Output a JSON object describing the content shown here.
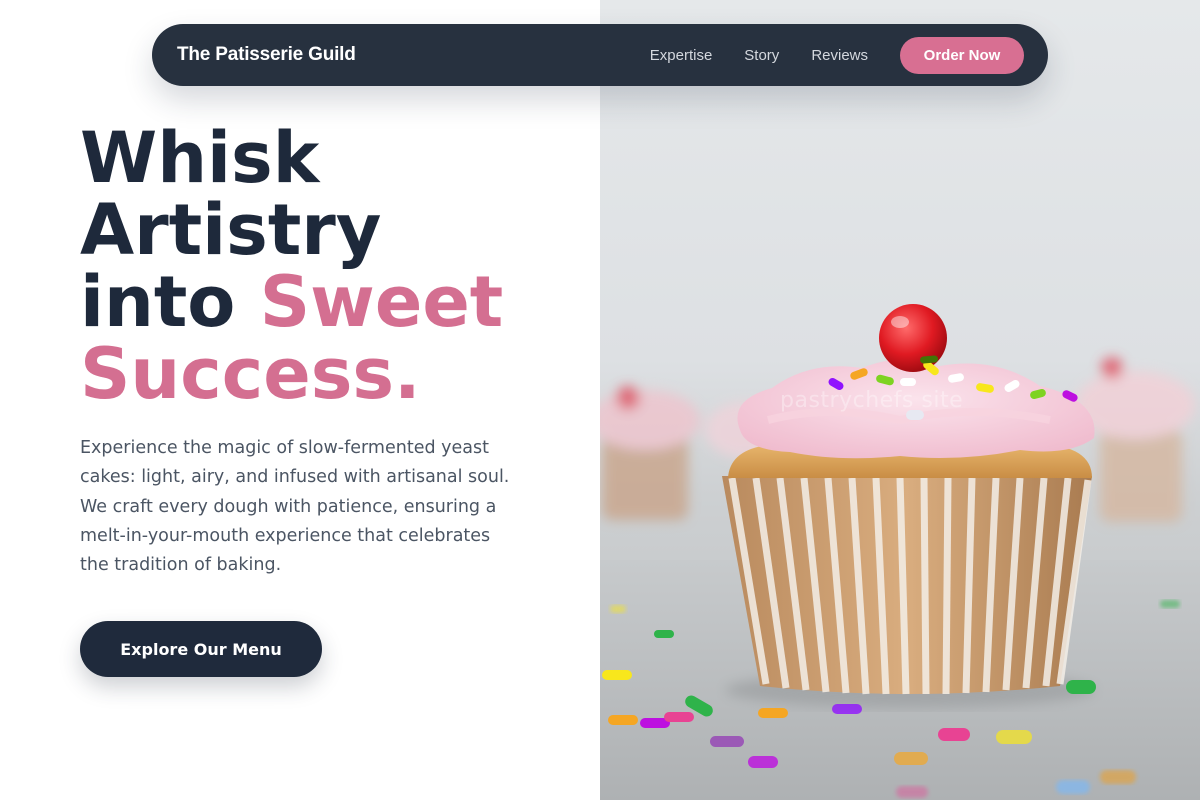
{
  "navbar": {
    "brand": "The Patisserie Guild",
    "links": [
      "Expertise",
      "Story",
      "Reviews"
    ],
    "cta_label": "Order Now"
  },
  "hero": {
    "headline_line1": "Whisk",
    "headline_line2": "Artistry",
    "headline_word3": "into",
    "headline_accent1": "Sweet",
    "headline_accent2": "Success.",
    "lead": "Experience the magic of slow-fermented yeast cakes: light, airy, and infused with artisanal soul. We craft every dough with patience, ensuring a melt-in-your-mouth experience that celebrates the tradition of baking.",
    "cta_label": "Explore Our Menu"
  },
  "photo": {
    "watermark": "pastrychefs site"
  },
  "colors": {
    "navy": "#1e293b",
    "pink_accent": "#d46f91",
    "order_button": "#d86f92",
    "navbar_bg": "#27313f"
  }
}
